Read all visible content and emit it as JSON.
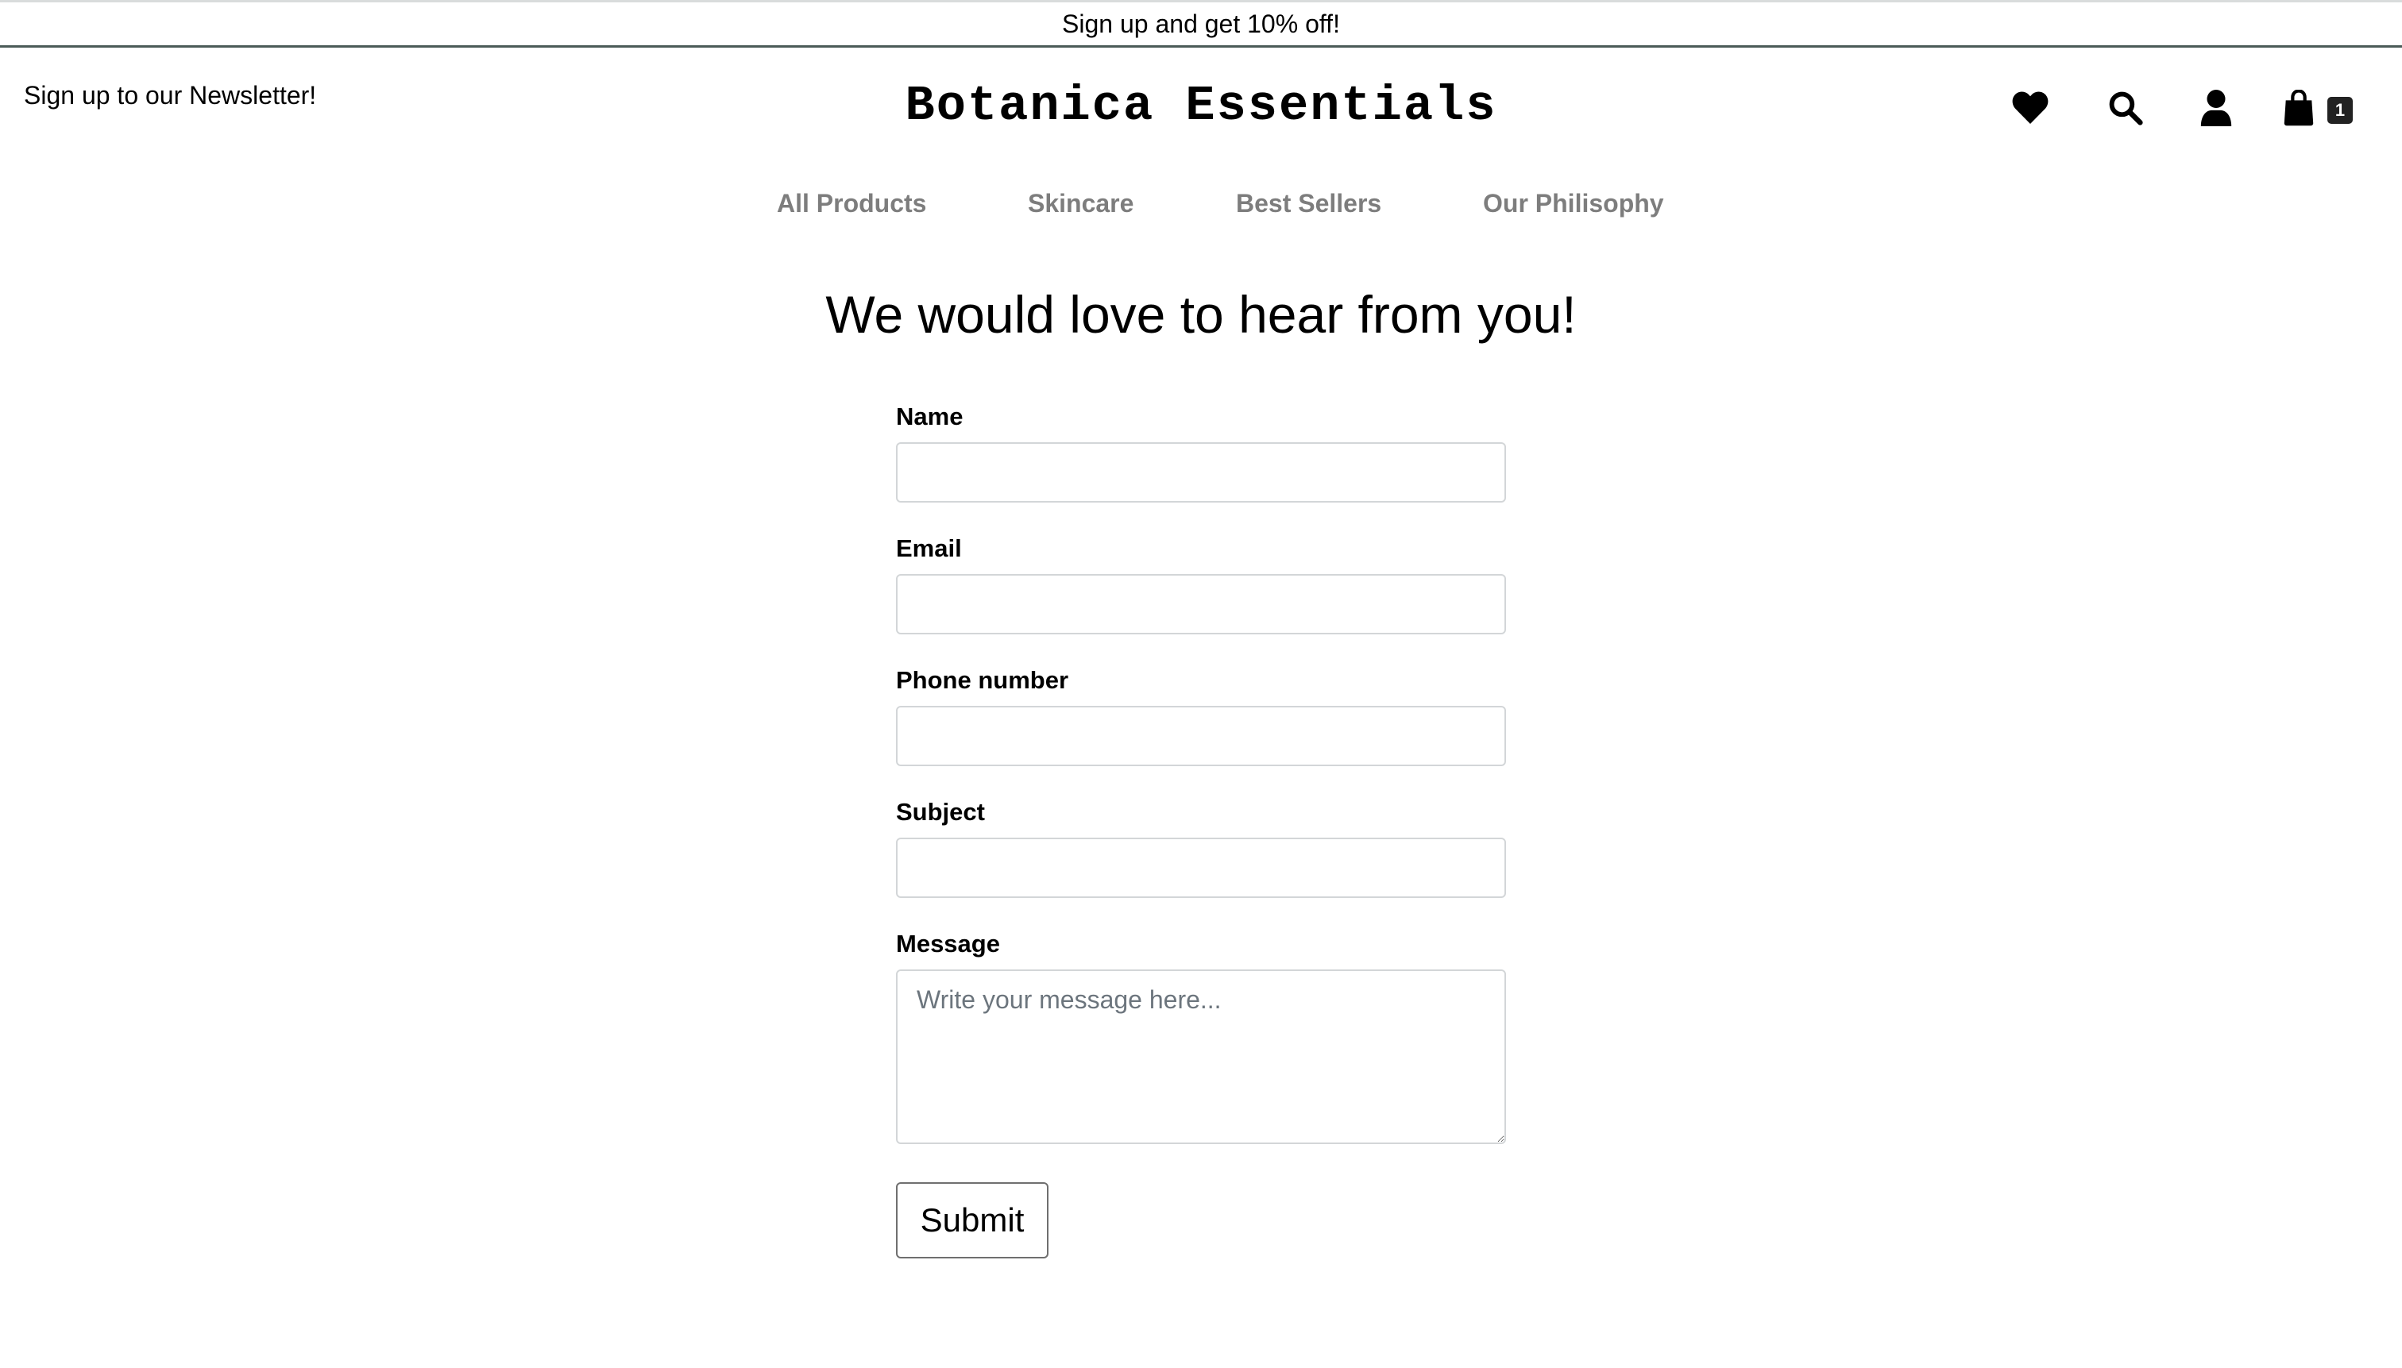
{
  "promo": {
    "text": "Sign up and get 10% off!"
  },
  "header": {
    "newsletter_link": "Sign up to our Newsletter!",
    "brand": "Botanica Essentials",
    "icons": [
      "heart-icon",
      "search-icon",
      "user-icon",
      "shopping-bag-icon"
    ],
    "cart_count": "1"
  },
  "nav": {
    "items": [
      "All Products",
      "Skincare",
      "Best Sellers",
      "Our Philisophy"
    ]
  },
  "main": {
    "heading": "We would love to hear from you!"
  },
  "form": {
    "name_label": "Name",
    "name_value": "",
    "email_label": "Email",
    "email_value": "",
    "phone_label": "Phone number",
    "phone_value": "",
    "subject_label": "Subject",
    "subject_value": "",
    "message_label": "Message",
    "message_placeholder": "Write your message here...",
    "submit_label": "Submit"
  },
  "colors": {
    "nav_text": "#7d7d7d",
    "promo_border": "#4a5a57",
    "input_border": "#d3d6d8",
    "cart_badge": "#222222"
  }
}
